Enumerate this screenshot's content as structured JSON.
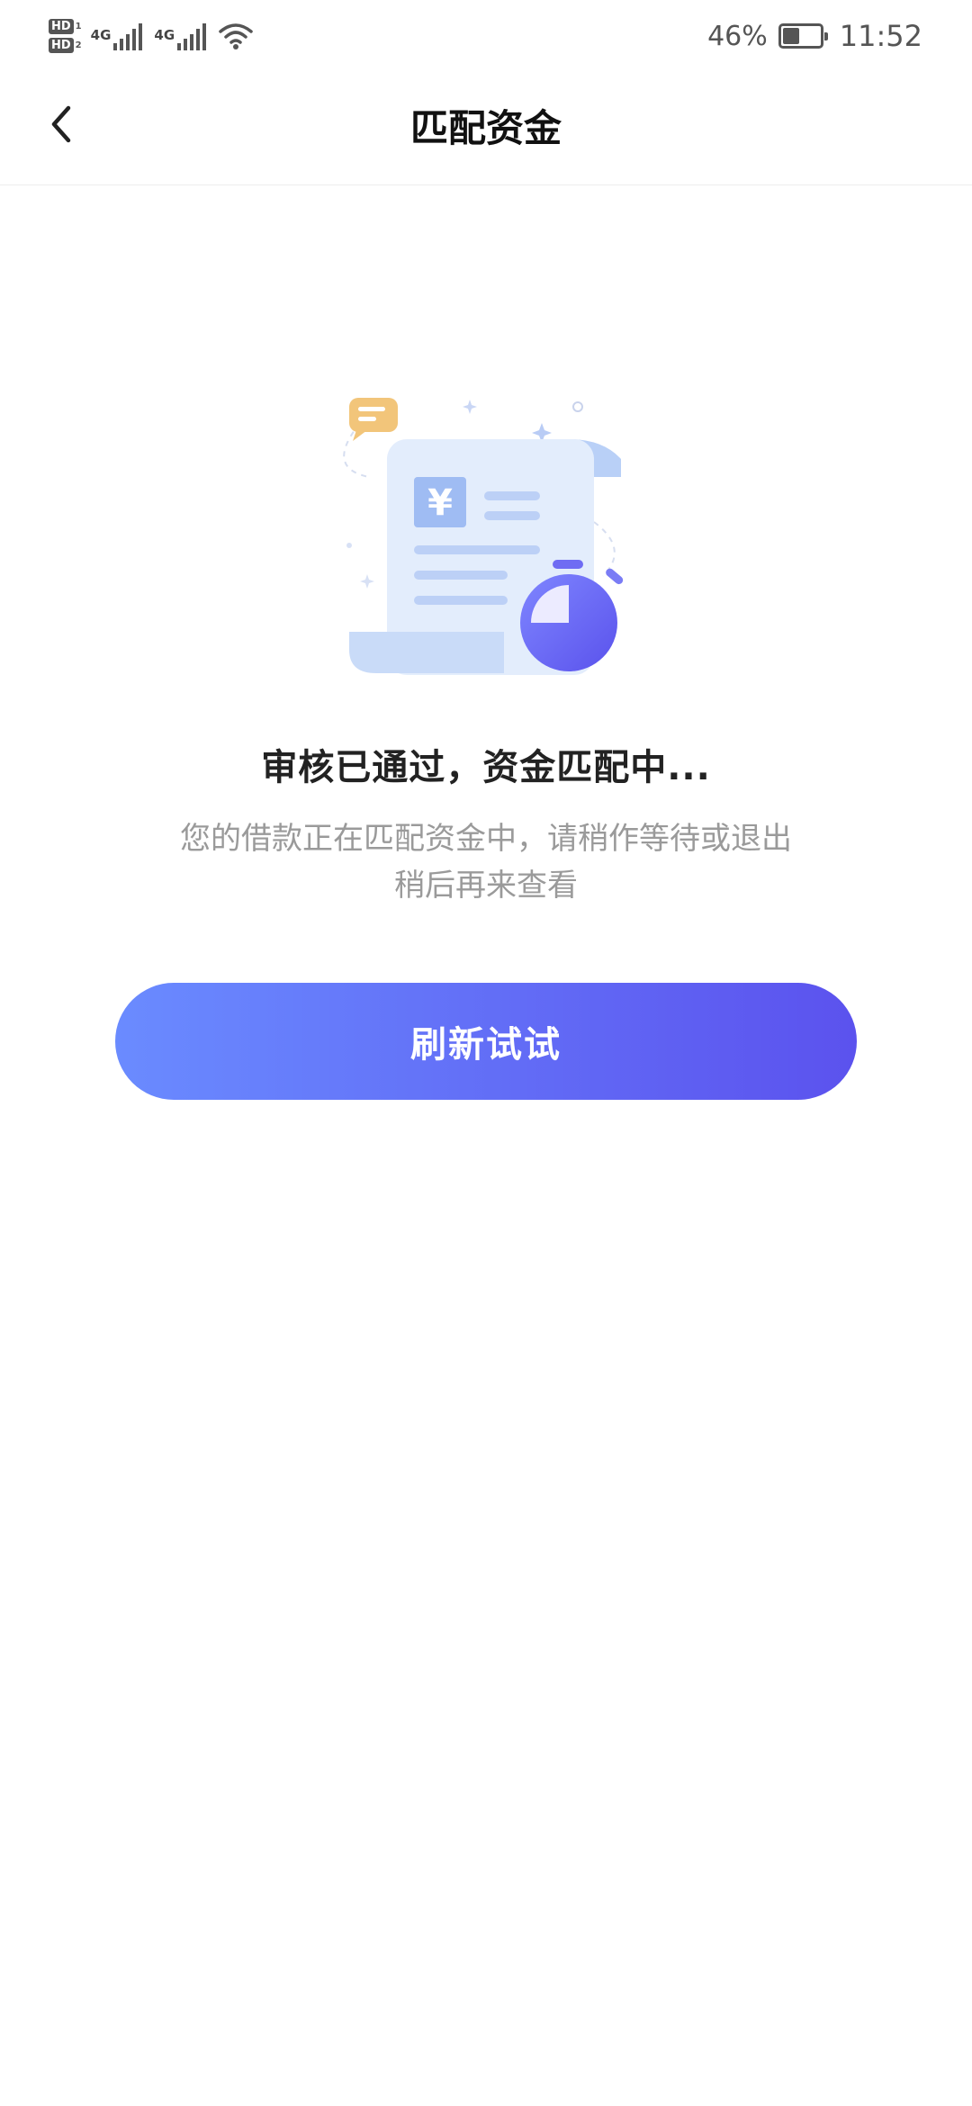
{
  "status_bar": {
    "sim1_badge": "HD",
    "sim1_num": "1",
    "sim2_badge": "HD",
    "sim2_num": "2",
    "network1": "4G",
    "network2": "4G",
    "battery_percent": "46%",
    "battery_level": 0.46,
    "time": "11:52"
  },
  "nav": {
    "title": "匹配资金",
    "back_icon": "chevron-left-icon"
  },
  "content": {
    "status_title": "审核已通过，资金匹配中...",
    "description": "您的借款正在匹配资金中，请稍作等待或退出稍后再来查看",
    "illustration_symbol": "¥"
  },
  "actions": {
    "refresh_label": "刷新试试"
  },
  "colors": {
    "button_gradient_start": "#6a8bff",
    "button_gradient_end": "#5b52ee",
    "title_color": "#222222",
    "desc_color": "#9a9a9a"
  }
}
